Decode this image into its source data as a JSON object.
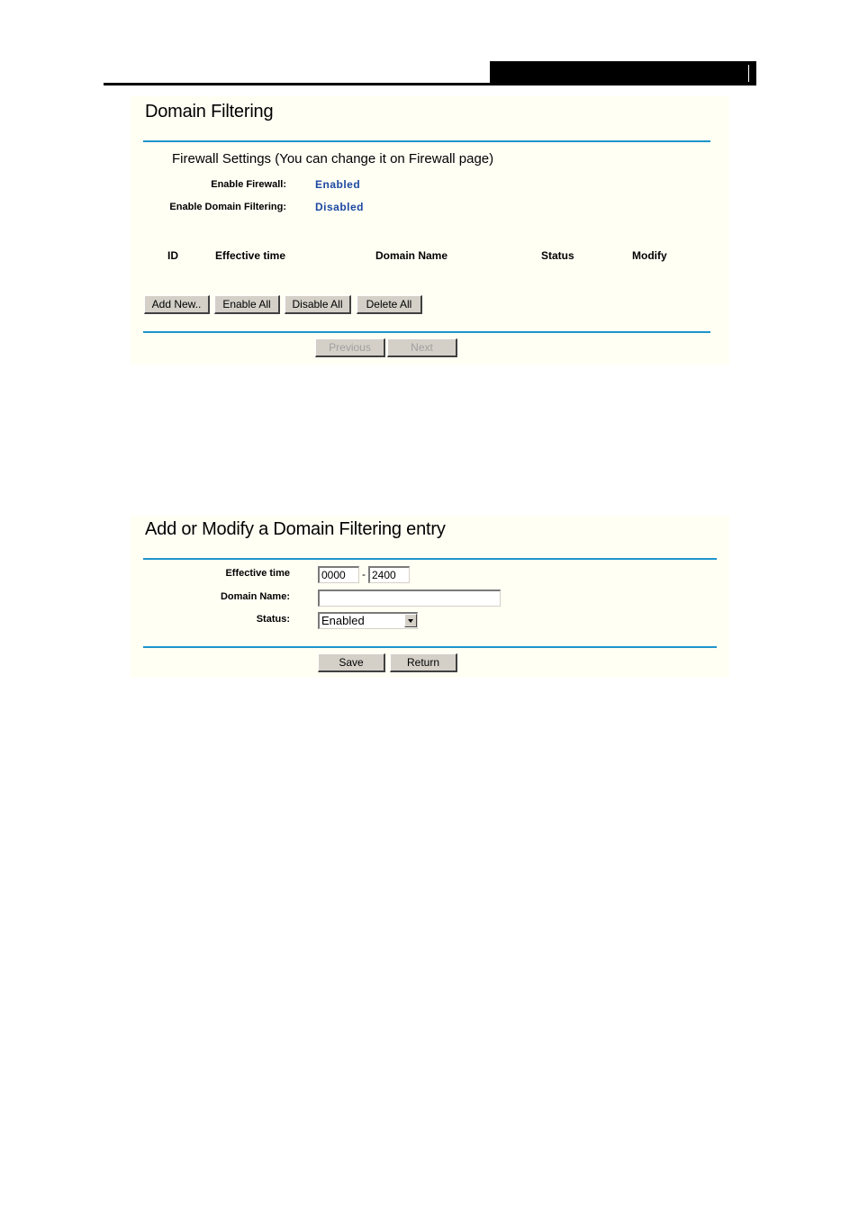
{
  "domain_filtering": {
    "title": "Domain Filtering",
    "firewall_settings_heading": "Firewall Settings (You can change it on Firewall page)",
    "enable_firewall_label": "Enable Firewall:",
    "enable_firewall_value": "Enabled",
    "enable_domain_filtering_label": "Enable Domain Filtering:",
    "enable_domain_filtering_value": "Disabled",
    "table": {
      "columns": [
        "ID",
        "Effective time",
        "Domain Name",
        "Status",
        "Modify"
      ],
      "rows": []
    },
    "buttons": {
      "add_new": "Add New..",
      "enable_all": "Enable All",
      "disable_all": "Disable All",
      "delete_all": "Delete All",
      "previous": "Previous",
      "next": "Next"
    }
  },
  "add_modify_entry": {
    "title": "Add or Modify a Domain Filtering entry",
    "effective_time_label": "Effective time",
    "effective_time_start": "0000",
    "effective_time_separator": "-",
    "effective_time_end": "2400",
    "domain_name_label": "Domain Name:",
    "domain_name_value": "",
    "status_label": "Status:",
    "status_selected": "Enabled",
    "buttons": {
      "save": "Save",
      "return": "Return"
    }
  },
  "colors": {
    "panel_background": "#fffff4",
    "rule": "#1e94cc",
    "value_text": "#1c48a0"
  }
}
